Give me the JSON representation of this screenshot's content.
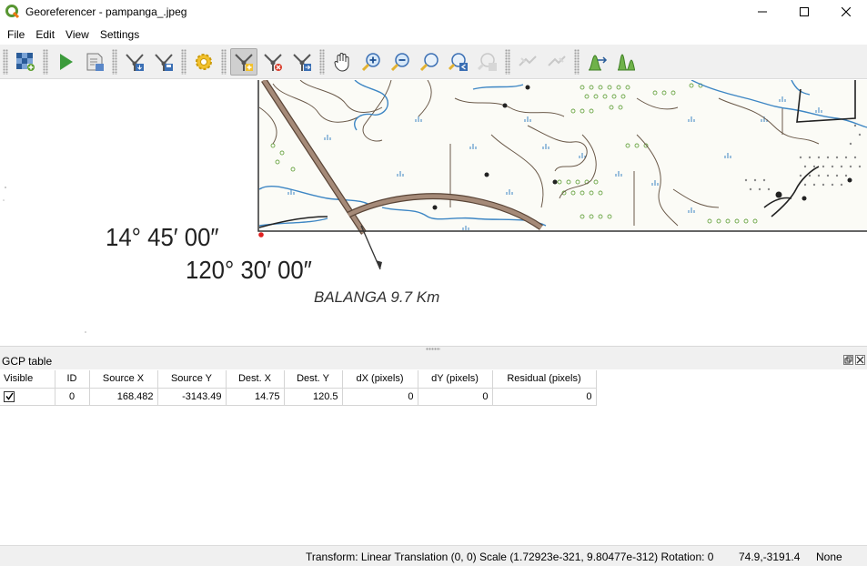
{
  "window": {
    "title": "Georeferencer - pampanga_.jpeg",
    "app_icon": "qgis-icon",
    "controls": [
      "minimize-icon",
      "maximize-icon",
      "close-icon"
    ]
  },
  "menu": {
    "items": [
      "File",
      "Edit",
      "View",
      "Settings"
    ]
  },
  "toolbar": {
    "buttons": [
      "open-raster-icon",
      "start-georeferencing-icon",
      "generate-gdal-script-icon",
      "load-gcp-points-icon",
      "save-gcp-points-icon",
      "transformation-settings-icon",
      "add-point-icon",
      "delete-point-icon",
      "move-gcp-point-icon",
      "pan-icon",
      "zoom-in-icon",
      "zoom-out-icon",
      "zoom-to-layer-icon",
      "zoom-last-icon",
      "zoom-next-icon",
      "link-georeferencer-to-qgis-icon",
      "link-qgis-to-georeferencer-icon",
      "full-histogram-stretch-icon",
      "local-histogram-stretch-icon"
    ]
  },
  "map": {
    "latitude_label": "14° 45′ 00″",
    "longitude_label": "120° 30′ 00″",
    "town_label": "BALANGA 9.7 Km"
  },
  "gcp_panel": {
    "title": "GCP table",
    "columns": [
      "Visible",
      "ID",
      "Source X",
      "Source Y",
      "Dest. X",
      "Dest. Y",
      "dX (pixels)",
      "dY (pixels)",
      "Residual (pixels)"
    ],
    "rows": [
      {
        "visible": true,
        "id": "0",
        "source_x": "168.482",
        "source_y": "-3143.49",
        "dest_x": "14.75",
        "dest_y": "120.5",
        "dx": "0",
        "dy": "0",
        "residual": "0"
      }
    ]
  },
  "status": {
    "transform": "Transform: Linear Translation (0, 0) Scale (1.72923e-321, 9.80477e-312) Rotation: 0",
    "coordinates": "74.9,-3191.4",
    "crs": "None"
  },
  "colors": {
    "road": "#a58a78",
    "river": "#3d86c4",
    "vegetation": "#6fa84a",
    "contour": "#6b5a4a",
    "gcp_point": "#e02020"
  }
}
